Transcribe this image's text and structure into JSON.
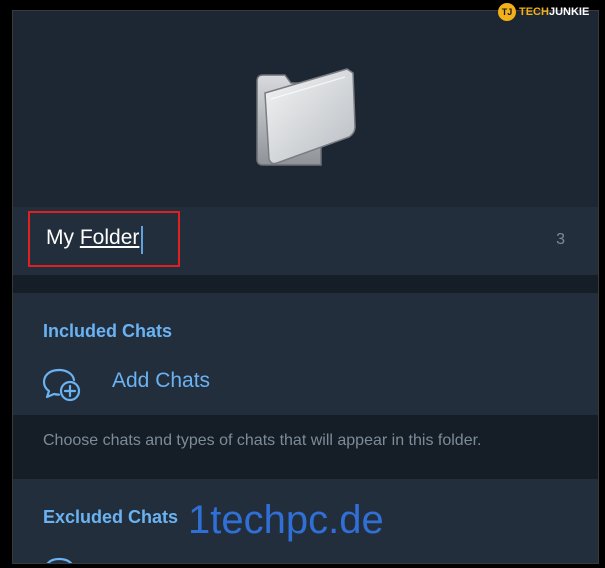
{
  "logo": {
    "badge": "TJ",
    "brand_part1": "TECH",
    "brand_part2": "JUNKIE"
  },
  "folder": {
    "icon": "folder-open-icon",
    "name_prefix": "My",
    "name_underlined": "Folder",
    "char_count": "3"
  },
  "included": {
    "title": "Included Chats",
    "add_chats_icon": "add-chat-icon",
    "add_chats_label": "Add Chats",
    "hint": "Choose chats and types of chats that will appear in this folder."
  },
  "excluded": {
    "title": "Excluded Chats"
  },
  "watermark": "1techpc.de",
  "colors": {
    "background": "#1d2733",
    "section": "#232e3c",
    "divider": "#151e27",
    "accent": "#6ab2f2",
    "highlight_box": "#e0201f",
    "watermark": "#2f6fd6"
  }
}
